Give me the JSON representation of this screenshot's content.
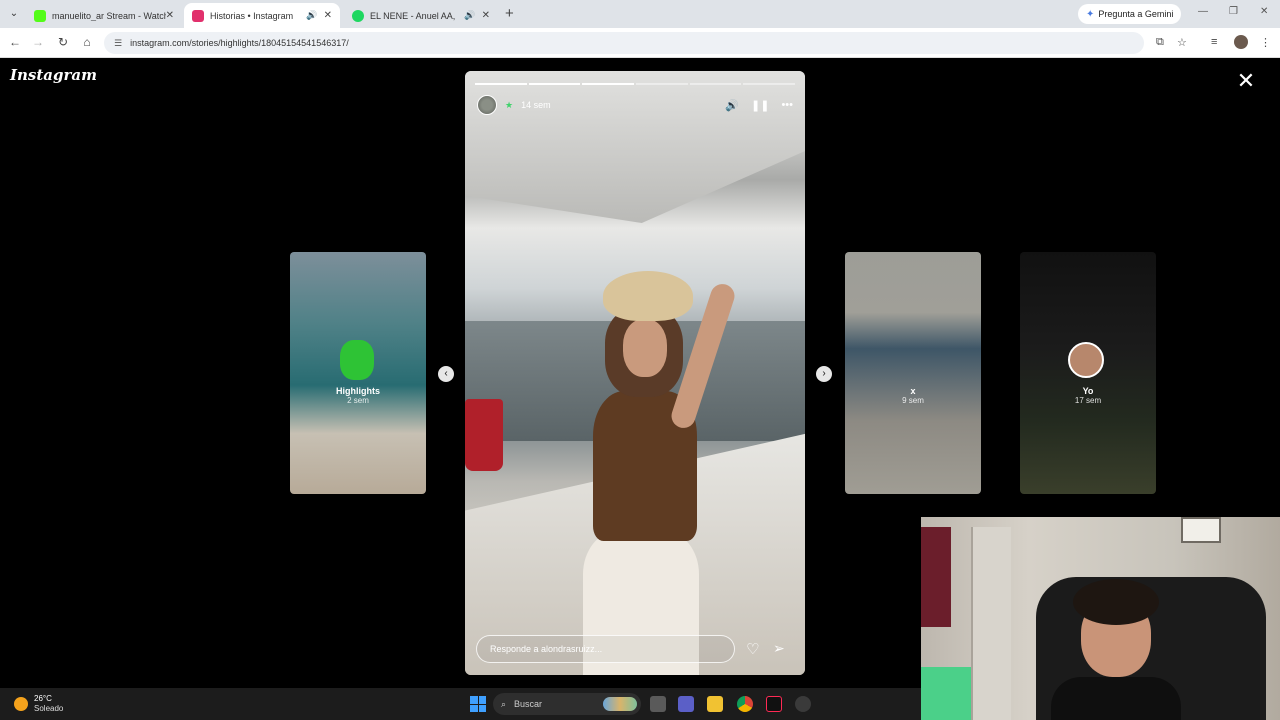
{
  "browser": {
    "tabs": [
      {
        "title": "manuelito_ar Stream - Watch L",
        "favicon_color": "#53fc18",
        "active": false
      },
      {
        "title": "Historias • Instagram",
        "favicon_color": "#e1306c",
        "active": true
      },
      {
        "title": "EL NENE - Anuel AA, Foreig",
        "favicon_color": "#1ed760",
        "active": false
      }
    ],
    "gemini_label": "Pregunta a Gemini",
    "url": "instagram.com/stories/highlights/18045154541546317/"
  },
  "instagram": {
    "logo": "Instagram",
    "current_story": {
      "time_ago": "14 sem",
      "segments_total": 6,
      "segments_done": 3,
      "reply_placeholder": "Responde a alondrasruizz..."
    },
    "side_stories": [
      {
        "name": "Highlights",
        "time_ago": "2 sem"
      },
      {
        "name": "x",
        "time_ago": "9 sem"
      },
      {
        "name": "Yo",
        "time_ago": "17 sem"
      }
    ]
  },
  "taskbar": {
    "weather_temp": "26°C",
    "weather_desc": "Soleado",
    "search_placeholder": "Buscar"
  }
}
